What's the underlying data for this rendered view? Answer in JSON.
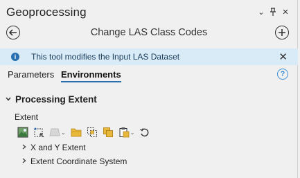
{
  "pane": {
    "title": "Geoprocessing",
    "icons": [
      "chevron-down-icon",
      "pin-icon",
      "close-icon"
    ]
  },
  "tool": {
    "title": "Change LAS Class Codes",
    "back_icon": "back-arrow-icon",
    "add_icon": "add-icon"
  },
  "info": {
    "text": "This tool modifies the Input LAS Dataset",
    "icon": "info-icon",
    "close_icon": "close-icon"
  },
  "tabs": [
    {
      "label": "Parameters",
      "active": false
    },
    {
      "label": "Environments",
      "active": true
    }
  ],
  "help_icon": "help-icon",
  "section": {
    "label": "Processing Extent",
    "expanded": true
  },
  "extent": {
    "label": "Extent",
    "toolbar": [
      {
        "name": "current-display-extent-icon"
      },
      {
        "name": "draw-extent-icon"
      },
      {
        "name": "layer-extent-icon",
        "dropdown": true
      },
      {
        "name": "browse-folder-icon"
      },
      {
        "name": "intersection-extent-icon"
      },
      {
        "name": "union-extent-icon"
      },
      {
        "name": "paste-extent-icon",
        "dropdown": true
      },
      {
        "name": "reset-icon"
      }
    ],
    "tree": [
      {
        "label": "X and Y Extent"
      },
      {
        "label": "Extent Coordinate System"
      }
    ]
  },
  "colors": {
    "accent": "#2a6fb0",
    "info_bg": "#d9ebf7",
    "help": "#3a8fd9",
    "folder": "#e8b83a"
  }
}
